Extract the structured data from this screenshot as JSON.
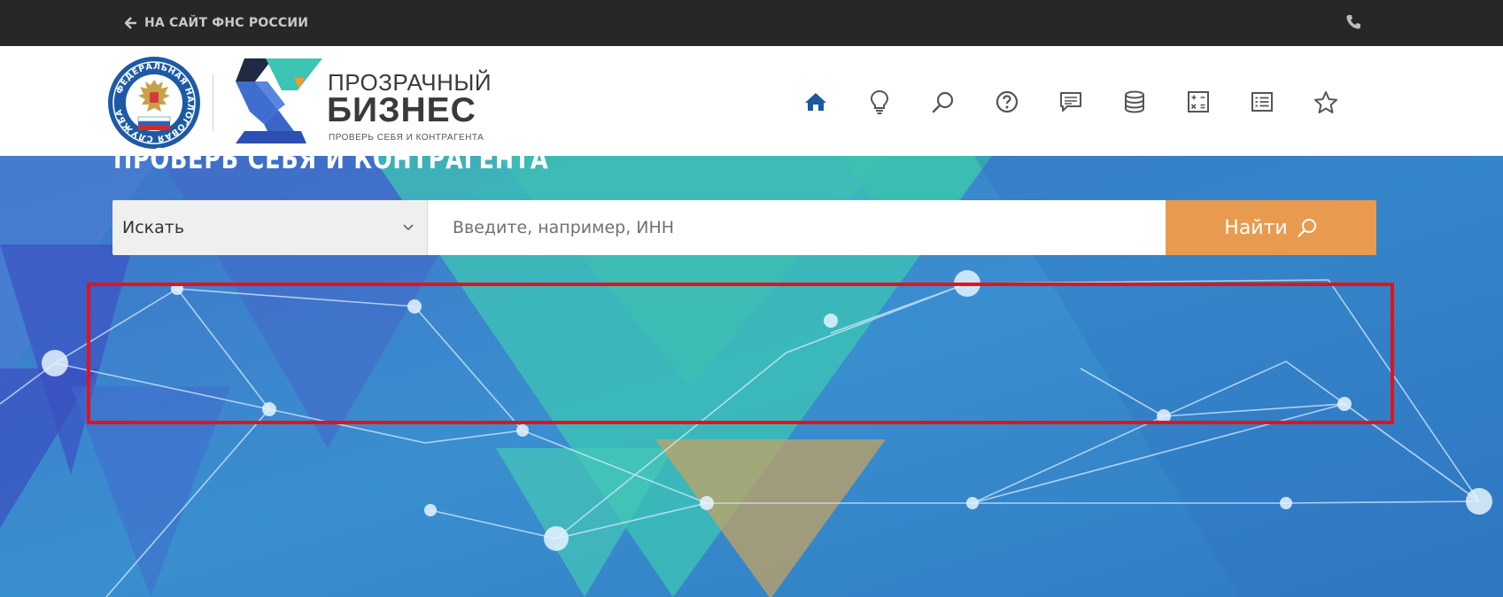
{
  "topbar": {
    "back_link_label": "НА САЙТ ФНС РОССИИ",
    "back_icon": "arrow-left-icon",
    "phone_icon": "phone-icon"
  },
  "header": {
    "emblem": {
      "ring_text": "ФЕДЕРАЛЬНАЯ НАЛОГОВАЯ СЛУЖБА"
    },
    "logo": {
      "title_line_1": "ПРОЗРАЧНЫЙ",
      "title_line_2": "БИЗНЕС",
      "tagline": "ПРОВЕРЬ СЕБЯ И КОНТРАГЕНТА"
    },
    "nav_icons": [
      "home-icon",
      "lightbulb-icon",
      "search-icon",
      "help-icon",
      "chat-icon",
      "database-icon",
      "calculator-icon",
      "list-icon",
      "star-icon"
    ],
    "active_nav": "home-icon"
  },
  "hero": {
    "title": "ПРОВЕРЬ СЕБЯ И КОНТРАГЕНТА",
    "search": {
      "type_selected": "Искать",
      "input_value": "",
      "input_placeholder": "Введите, например, ИНН",
      "button_label": "Найти"
    }
  },
  "colors": {
    "topbar_bg": "#272727",
    "nav_active": "#1a5aa0",
    "nav_icon": "#555555",
    "hero_blue": "#3577c7",
    "hero_teal": "#3cc5b4",
    "search_button": "#e89b4e",
    "highlight_border": "#e0141b"
  }
}
